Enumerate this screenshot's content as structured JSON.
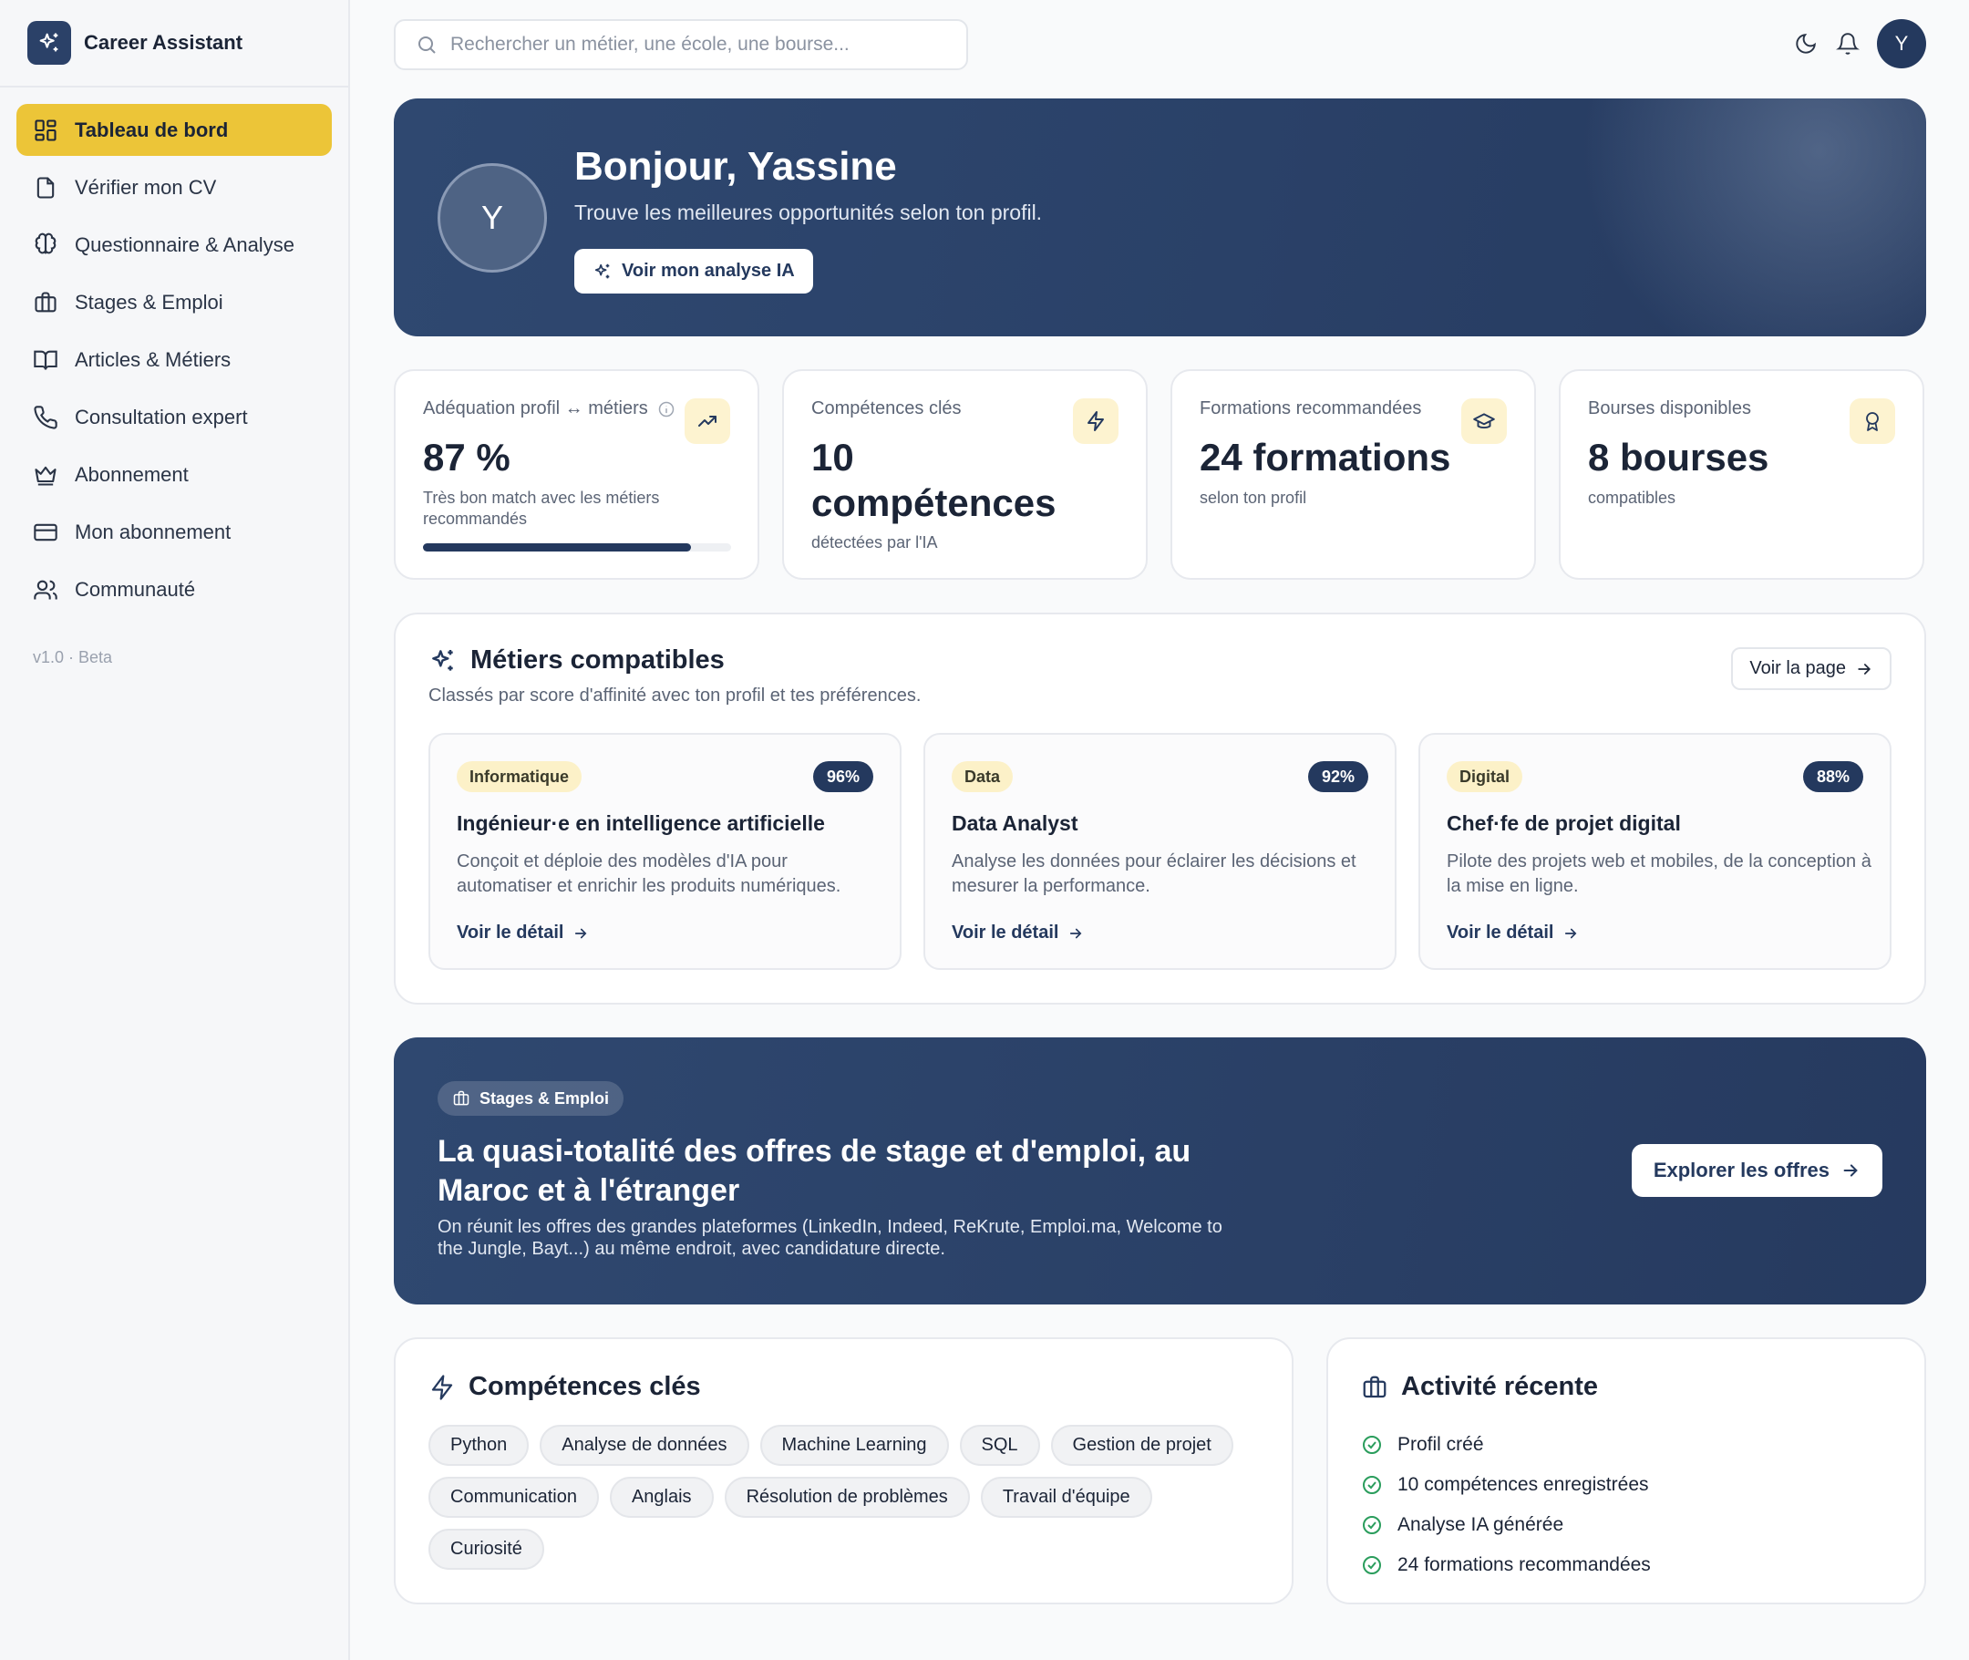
{
  "app": {
    "name": "Career Assistant",
    "version": "v1.0 · Beta"
  },
  "sidebar": {
    "items": [
      {
        "label": "Tableau de bord",
        "icon": "dashboard-icon",
        "active": true
      },
      {
        "label": "Vérifier mon CV",
        "icon": "file-icon"
      },
      {
        "label": "Questionnaire & Analyse",
        "icon": "brain-icon"
      },
      {
        "label": "Stages & Emploi",
        "icon": "briefcase-icon"
      },
      {
        "label": "Articles & Métiers",
        "icon": "book-icon"
      },
      {
        "label": "Consultation expert",
        "icon": "phone-icon"
      },
      {
        "label": "Abonnement",
        "icon": "crown-icon"
      },
      {
        "label": "Mon abonnement",
        "icon": "credit-card-icon"
      },
      {
        "label": "Communauté",
        "icon": "users-icon"
      }
    ]
  },
  "topbar": {
    "search_placeholder": "Rechercher un métier, une école, une bourse...",
    "avatar_initial": "Y"
  },
  "hero": {
    "avatar_initial": "Y",
    "title": "Bonjour, Yassine",
    "subtitle": "Trouve les meilleures opportunités selon ton profil.",
    "button": "Voir mon analyse IA"
  },
  "stats": [
    {
      "label": "Adéquation profil ↔ métiers",
      "value": "87 %",
      "sub": "Très bon match avec les métiers recommandés",
      "progress": 0.87,
      "icon": "trending-up-icon"
    },
    {
      "label": "Compétences clés",
      "value": "10 compétences",
      "sub": "détectées par l'IA",
      "icon": "zap-icon"
    },
    {
      "label": "Formations recommandées",
      "value": "24 formations",
      "sub": "selon ton profil",
      "icon": "graduation-cap-icon"
    },
    {
      "label": "Bourses disponibles",
      "value": "8 bourses",
      "sub": "compatibles",
      "icon": "award-icon"
    }
  ],
  "jobs_section": {
    "title": "Métiers compatibles",
    "subtitle": "Classés par score d'affinité avec ton profil et tes préférences.",
    "page_button": "Voir la page",
    "jobs": [
      {
        "tag": "Informatique",
        "score": "96%",
        "title": "Ingénieur·e en intelligence artificielle",
        "desc": "Conçoit et déploie des modèles d'IA pour automatiser et enrichir les produits numériques.",
        "link": "Voir le détail"
      },
      {
        "tag": "Data",
        "score": "92%",
        "title": "Data Analyst",
        "desc": "Analyse les données pour éclairer les décisions et mesurer la performance.",
        "link": "Voir le détail"
      },
      {
        "tag": "Digital",
        "score": "88%",
        "title": "Chef·fe de projet digital",
        "desc": "Pilote des projets web et mobiles, de la conception à la mise en ligne.",
        "link": "Voir le détail"
      }
    ]
  },
  "banner": {
    "pill": "Stages & Emploi",
    "title": "La quasi-totalité des offres de stage et d'emploi, au Maroc et à l'étranger",
    "subtitle": "On réunit les offres des grandes plateformes (LinkedIn, Indeed, ReKrute, Emploi.ma, Welcome to the Jungle, Bayt...) au même endroit, avec candidature directe.",
    "button": "Explorer les offres"
  },
  "skills": {
    "title": "Compétences clés",
    "items": [
      "Python",
      "Analyse de données",
      "Machine Learning",
      "SQL",
      "Gestion de projet",
      "Communication",
      "Anglais",
      "Résolution de problèmes",
      "Travail d'équipe",
      "Curiosité"
    ]
  },
  "activity": {
    "title": "Activité récente",
    "items": [
      "Profil créé",
      "10 compétences enregistrées",
      "Analyse IA générée",
      "24 formations recommandées"
    ]
  },
  "colors": {
    "primary": "#24395e",
    "accent": "#ecc538",
    "success": "#2a9d5c"
  }
}
